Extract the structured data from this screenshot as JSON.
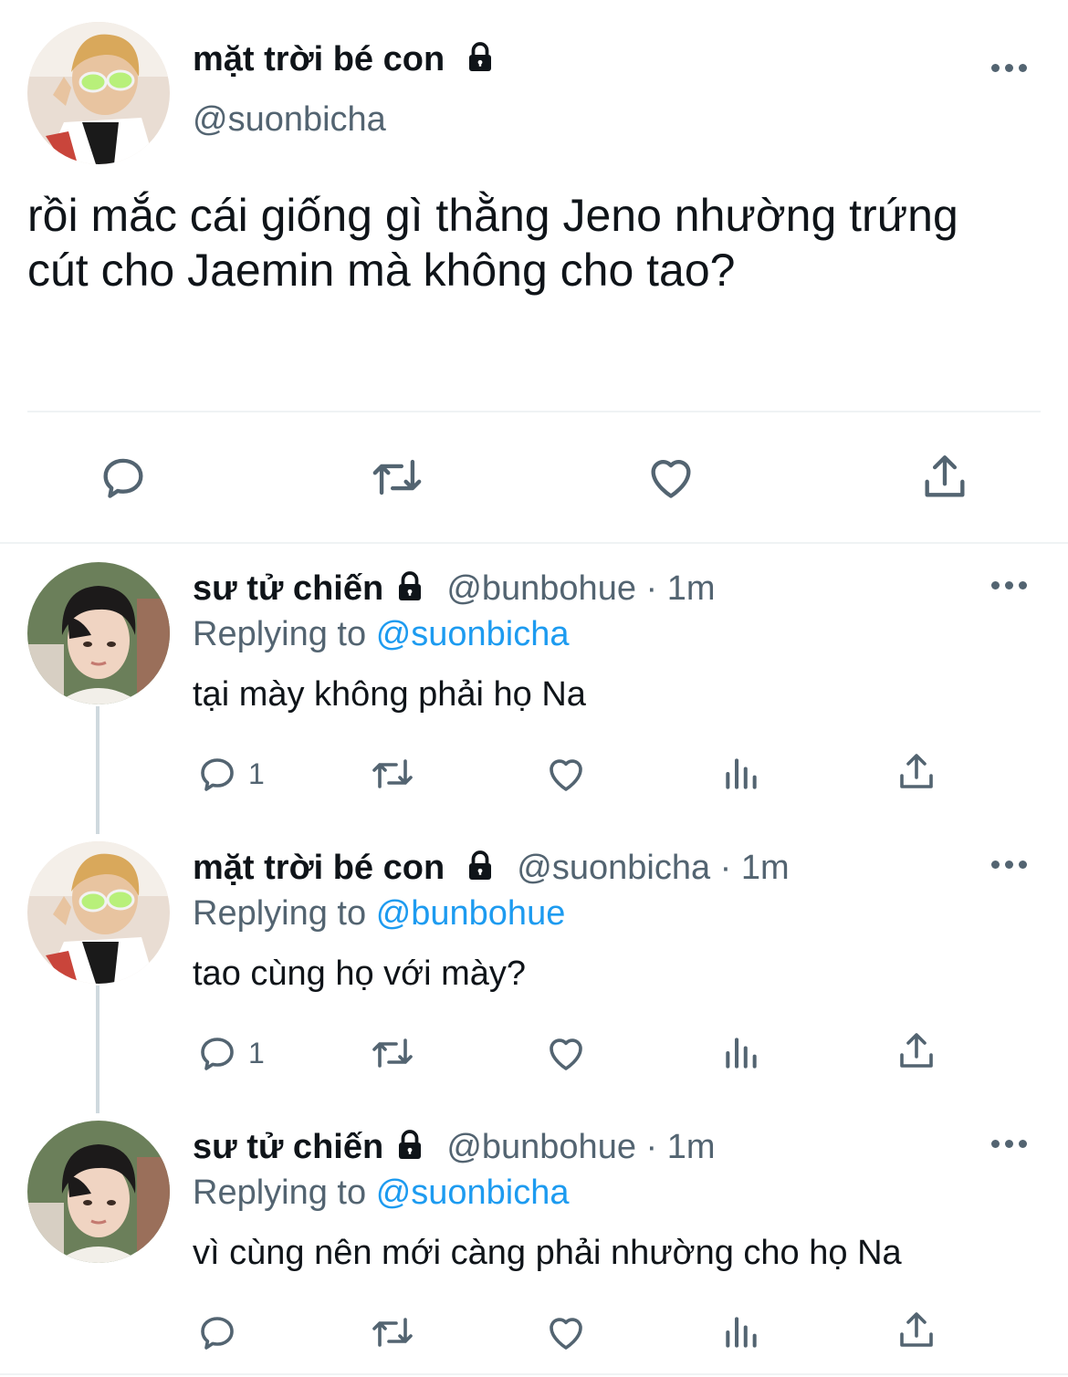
{
  "tweet": {
    "author_name": "mặt trời bé con",
    "author_handle": "@suonbicha",
    "text_line1": "rồi mắc cái giống gì thằng Jeno nhường trứng",
    "text_line2": "cút cho Jaemin mà không cho tao?"
  },
  "replies": [
    {
      "author_name": "sư tử chiến",
      "handle_time": "@bunbohue · 1m",
      "replying_label": "Replying to",
      "replying_handle": "@suonbicha",
      "text": "tại mày không phải họ Na",
      "reply_count": "1"
    },
    {
      "author_name": "mặt trời bé con",
      "handle_time": "@suonbicha · 1m",
      "replying_label": "Replying to",
      "replying_handle": "@bunbohue",
      "text": "tao cùng họ với mày?",
      "reply_count": "1"
    },
    {
      "author_name": "sư tử chiến",
      "handle_time": "@bunbohue · 1m",
      "replying_label": "Replying to",
      "replying_handle": "@suonbicha",
      "text": "vì cùng nên mới càng phải nhường cho họ Na",
      "reply_count": ""
    }
  ],
  "icons": {
    "reply": "reply-icon",
    "retweet": "retweet-icon",
    "like": "like-icon",
    "share": "share-icon",
    "analytics": "analytics-icon",
    "lock": "lock-icon",
    "more": "more-icon"
  },
  "colors": {
    "text": "#0f1419",
    "secondary": "#536471",
    "link": "#1d9bf0",
    "divider": "#eff3f4",
    "thread_line": "#cfd9de"
  }
}
